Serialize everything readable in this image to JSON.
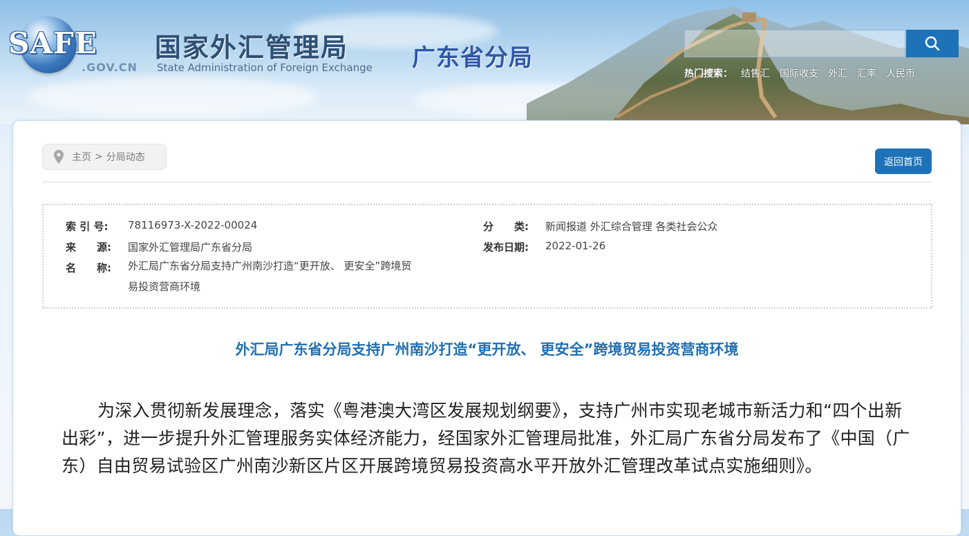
{
  "header": {
    "logo_text": "SAFE",
    "logo_domain": ".GOV.CN",
    "title_cn": "国家外汇管理局",
    "title_en": "State Administration of Foreign Exchange",
    "branch": "广东省分局",
    "search": {
      "placeholder": "",
      "button_icon": "search-icon"
    },
    "hot_label": "热门搜索：",
    "hot_links": [
      "结售汇",
      "国际收支",
      "外汇",
      "汇率",
      "人民币"
    ]
  },
  "breadcrumb": {
    "home": "主页",
    "separator": ">",
    "current": "分局动态"
  },
  "back_button": "返回首页",
  "meta": {
    "index_label": "索 引 号:",
    "index_value": "78116973-X-2022-00024",
    "category_label": "分　　类:",
    "category_value": "新闻报道 外汇综合管理 各类社会公众",
    "source_label": "来　　源:",
    "source_value": "国家外汇管理局广东省分局",
    "date_label": "发布日期:",
    "date_value": "2022-01-26",
    "name_label": "名　　称:",
    "name_value_line1": "外汇局广东省分局支持广州南沙打造“更开放、 更安全”跨境贸",
    "name_value_line2": "易投资营商环境"
  },
  "article": {
    "title": "外汇局广东省分局支持广州南沙打造“更开放、 更安全”跨境贸易投资营商环境",
    "paragraph": "为深入贯彻新发展理念，落实《粤港澳大湾区发展规划纲要》，支持广州市实现老城市新活力和“四个出新出彩”，进一步提升外汇管理服务实体经济能力，经国家外汇管理局批准，外汇局广东省分局发布了《中国（广东）自由贸易试验区广州南沙新区片区开展跨境贸易投资高水平开放外汇管理改革试点实施细则》。"
  },
  "colors": {
    "accent": "#1d72b8",
    "title_blue": "#1f6fb2",
    "branch_blue": "#2f57a5"
  }
}
